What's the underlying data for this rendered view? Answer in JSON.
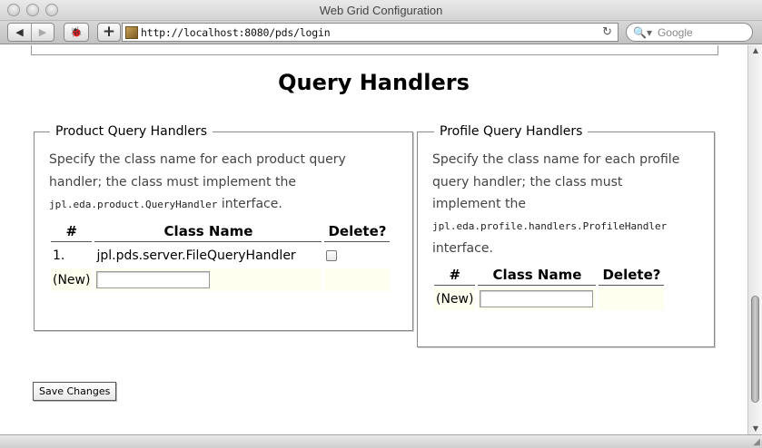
{
  "window": {
    "title": "Web Grid Configuration"
  },
  "toolbar": {
    "back_icon": "◀",
    "forward_icon": "▶",
    "bug_icon": "🐞",
    "plus_label": "+",
    "url": "http://localhost:8080/pds/login",
    "reload_icon": "↻",
    "search_icon": "🔍▾",
    "search_placeholder": "Google"
  },
  "page": {
    "title": "Query Handlers",
    "product_panel": {
      "legend": "Product Query Handlers",
      "desc_line1": "Specify the class name for each product query",
      "desc_line2": "handler; the class must implement the",
      "desc_interface": "jpl.eda.product.QueryHandler",
      "desc_suffix": " interface.",
      "columns": [
        "#",
        "Class Name",
        "Delete?"
      ],
      "rows": [
        {
          "num": "1.",
          "class_name": "jpl.pds.server.FileQueryHandler"
        }
      ],
      "new_label": "(New)",
      "new_value": ""
    },
    "profile_panel": {
      "legend": "Profile Query Handlers",
      "desc_line1": "Specify the class name for each profile",
      "desc_line2": "query handler; the class must",
      "desc_line3": "implement the",
      "desc_interface": "jpl.eda.profile.handlers.ProfileHandler",
      "desc_suffix": "interface.",
      "columns": [
        "#",
        "Class Name",
        "Delete?"
      ],
      "new_label": "(New)",
      "new_value": ""
    },
    "save_label": "Save Changes"
  },
  "scrollbar": {
    "up_icon": "▲",
    "down_icon": "▼"
  },
  "statusbar": {
    "grip_icon": "◢"
  }
}
